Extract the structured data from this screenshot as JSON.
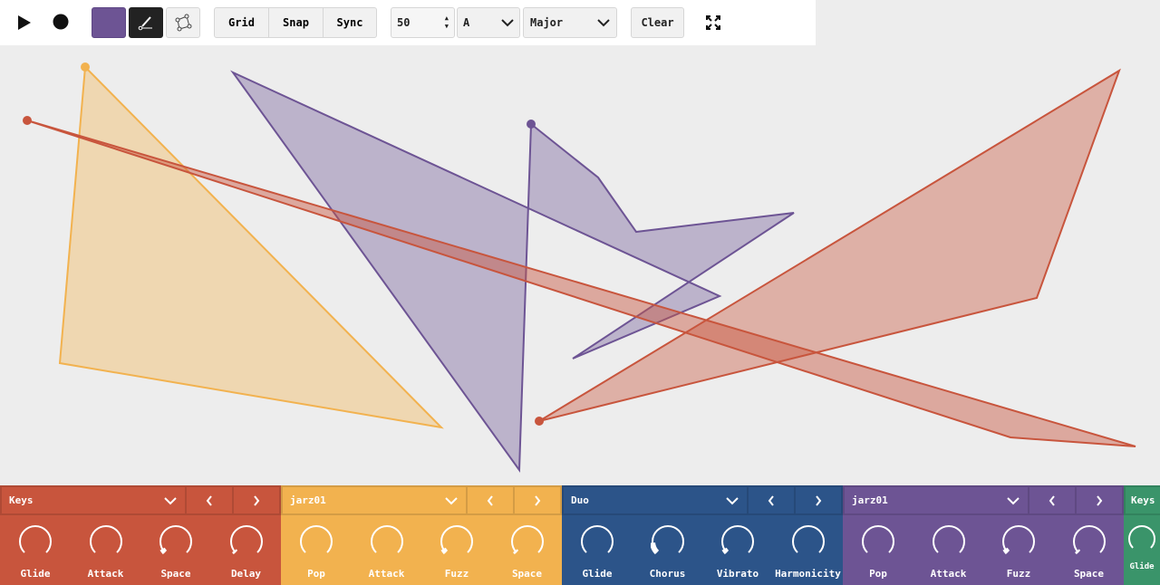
{
  "toolbar": {
    "grid": "Grid",
    "snap": "Snap",
    "sync": "Sync",
    "tempo": "50",
    "key": "A",
    "scale": "Major",
    "clear": "Clear",
    "current_color": "#6d5494"
  },
  "panels": [
    {
      "name": "Keys",
      "color": "#c8553d",
      "knobs": [
        {
          "label": "Glide",
          "value": 0
        },
        {
          "label": "Attack",
          "value": 0
        },
        {
          "label": "Space",
          "value": 0.06
        },
        {
          "label": "Delay",
          "value": 0.03
        }
      ]
    },
    {
      "name": "jarz01",
      "color": "#f2b24f",
      "knobs": [
        {
          "label": "Pop",
          "value": 0
        },
        {
          "label": "Attack",
          "value": 0
        },
        {
          "label": "Fuzz",
          "value": 0.06
        },
        {
          "label": "Space",
          "value": 0.03
        }
      ]
    },
    {
      "name": "Duo",
      "color": "#2c5489",
      "knobs": [
        {
          "label": "Glide",
          "value": 0
        },
        {
          "label": "Chorus",
          "value": 0.15
        },
        {
          "label": "Vibrato",
          "value": 0.06
        },
        {
          "label": "Harmonicity",
          "value": 0
        }
      ]
    },
    {
      "name": "jarz01",
      "color": "#6d5494",
      "knobs": [
        {
          "label": "Pop",
          "value": 0
        },
        {
          "label": "Attack",
          "value": 0
        },
        {
          "label": "Fuzz",
          "value": 0.06
        },
        {
          "label": "Space",
          "value": 0.03
        }
      ]
    },
    {
      "name": "Keys",
      "color": "#3a946a",
      "knobs": [
        {
          "label": "Glide",
          "value": 0
        }
      ]
    }
  ]
}
